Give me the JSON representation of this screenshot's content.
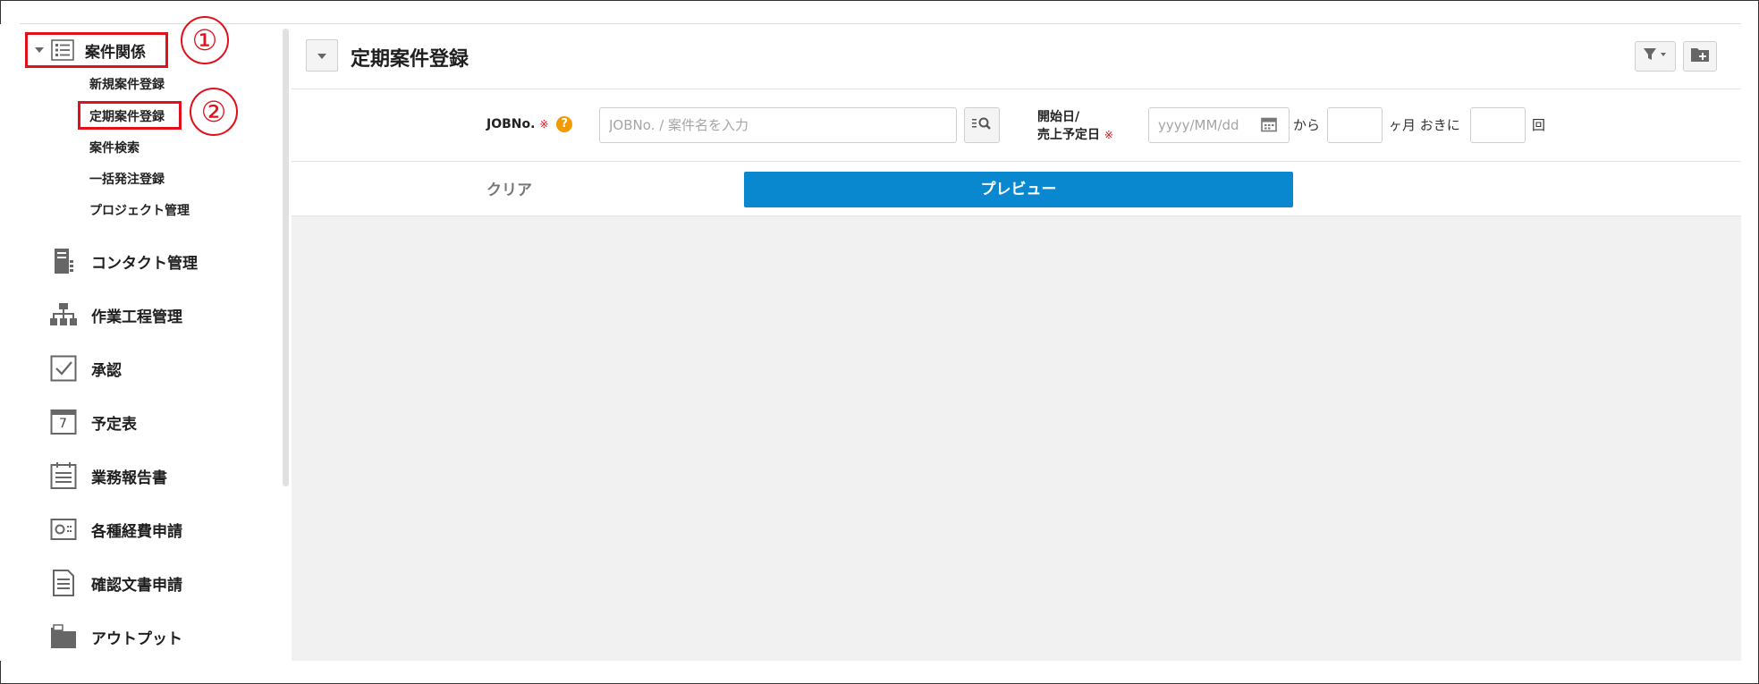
{
  "sidebar": {
    "top": {
      "label": "案件関係",
      "icon": "list-icon",
      "annotation": "①"
    },
    "subitems": [
      {
        "label": "新規案件登録"
      },
      {
        "label": "定期案件登録",
        "annotation": "②"
      },
      {
        "label": "案件検索"
      },
      {
        "label": "一括発注登録"
      },
      {
        "label": "プロジェクト管理"
      }
    ],
    "items": [
      {
        "label": "コンタクト管理",
        "icon": "contact-icon"
      },
      {
        "label": "作業工程管理",
        "icon": "workflow-icon"
      },
      {
        "label": "承認",
        "icon": "checkbox-icon"
      },
      {
        "label": "予定表",
        "icon": "calendar-icon",
        "icon_text": "7"
      },
      {
        "label": "業務報告書",
        "icon": "report-icon"
      },
      {
        "label": "各種経費申請",
        "icon": "expense-icon"
      },
      {
        "label": "確認文書申請",
        "icon": "document-icon"
      },
      {
        "label": "アウトプット",
        "icon": "folder-icon"
      }
    ]
  },
  "header": {
    "title": "定期案件登録",
    "filter_icon": "filter-icon",
    "add_icon": "add-folder-icon"
  },
  "form": {
    "job": {
      "label": "JOBNo.",
      "required_mark": "※",
      "help": "?",
      "placeholder": "JOBNo. / 案件名を入力"
    },
    "start": {
      "label_line1": "開始日/",
      "label_line2": "売上予定日",
      "required_mark": "※",
      "placeholder": "yyyy/MM/dd"
    },
    "from_text": "から",
    "interval_text": "ヶ月 おきに",
    "times_text": "回"
  },
  "actions": {
    "clear": "クリア",
    "preview": "プレビュー"
  },
  "colors": {
    "accent": "#0a88cf",
    "annotation_red": "#e0111b",
    "help_orange": "#f29b00",
    "content_bg": "#f1f1f1"
  }
}
